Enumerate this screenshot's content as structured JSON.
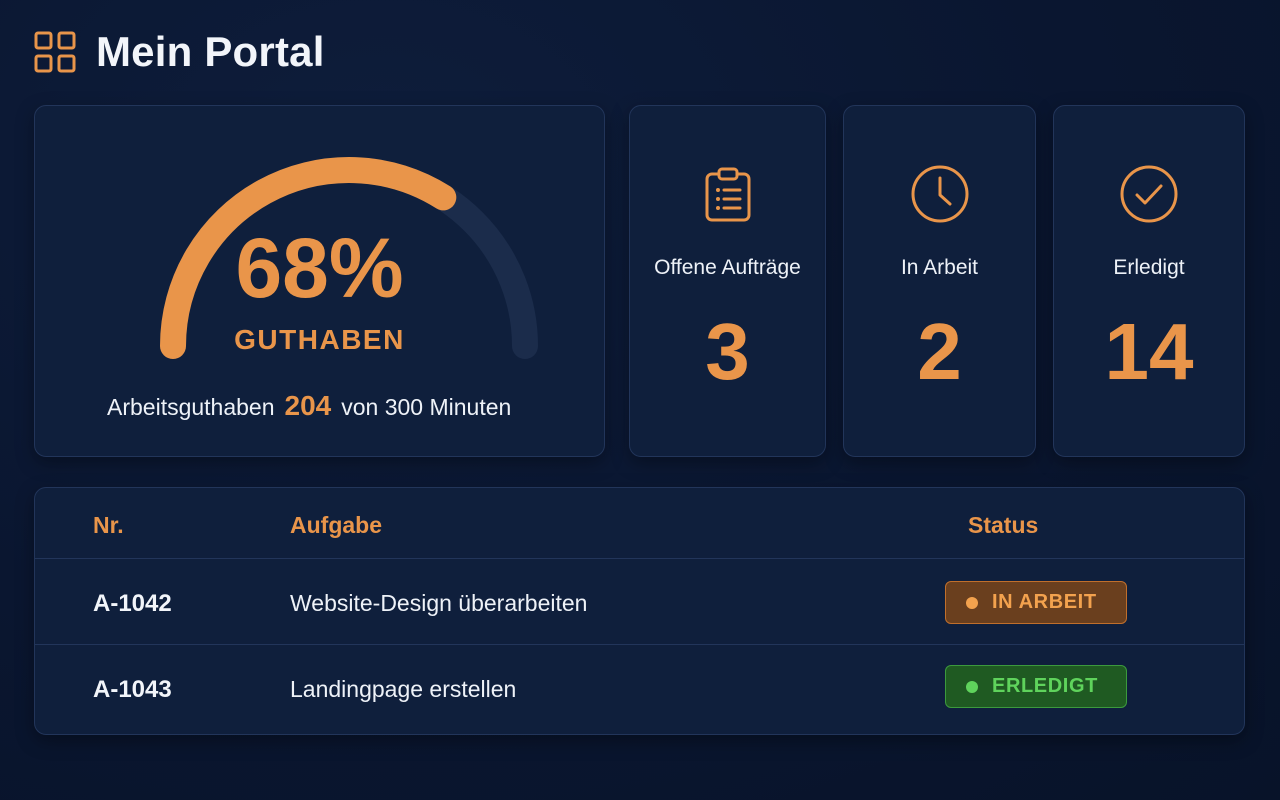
{
  "header": {
    "title": "Mein Portal",
    "icon": "dashboard-grid-icon"
  },
  "colors": {
    "accent": "#e9954a",
    "background": "#0b1731",
    "card": "#0f1f3c",
    "success": "#5fd35c"
  },
  "credit": {
    "percent_text": "68%",
    "percent_value": 0.68,
    "label": "GUTHABEN",
    "caption_prefix": "Arbeitsguthaben",
    "used": "204",
    "caption_suffix": "von 300 Minuten"
  },
  "stats": [
    {
      "icon": "clipboard-list-icon",
      "label": "Offene Aufträge",
      "value": "3"
    },
    {
      "icon": "clock-icon",
      "label": "In Arbeit",
      "value": "2"
    },
    {
      "icon": "check-circle-icon",
      "label": "Erledigt",
      "value": "14"
    }
  ],
  "table": {
    "headers": {
      "nr": "Nr.",
      "task": "Aufgabe",
      "status": "Status"
    },
    "rows": [
      {
        "nr": "A-1042",
        "task": "Website-Design überarbeiten",
        "status": "IN ARBEIT",
        "status_kind": "in-progress"
      },
      {
        "nr": "A-1043",
        "task": "Landingpage erstellen",
        "status": "ERLEDIGT",
        "status_kind": "done"
      }
    ]
  }
}
